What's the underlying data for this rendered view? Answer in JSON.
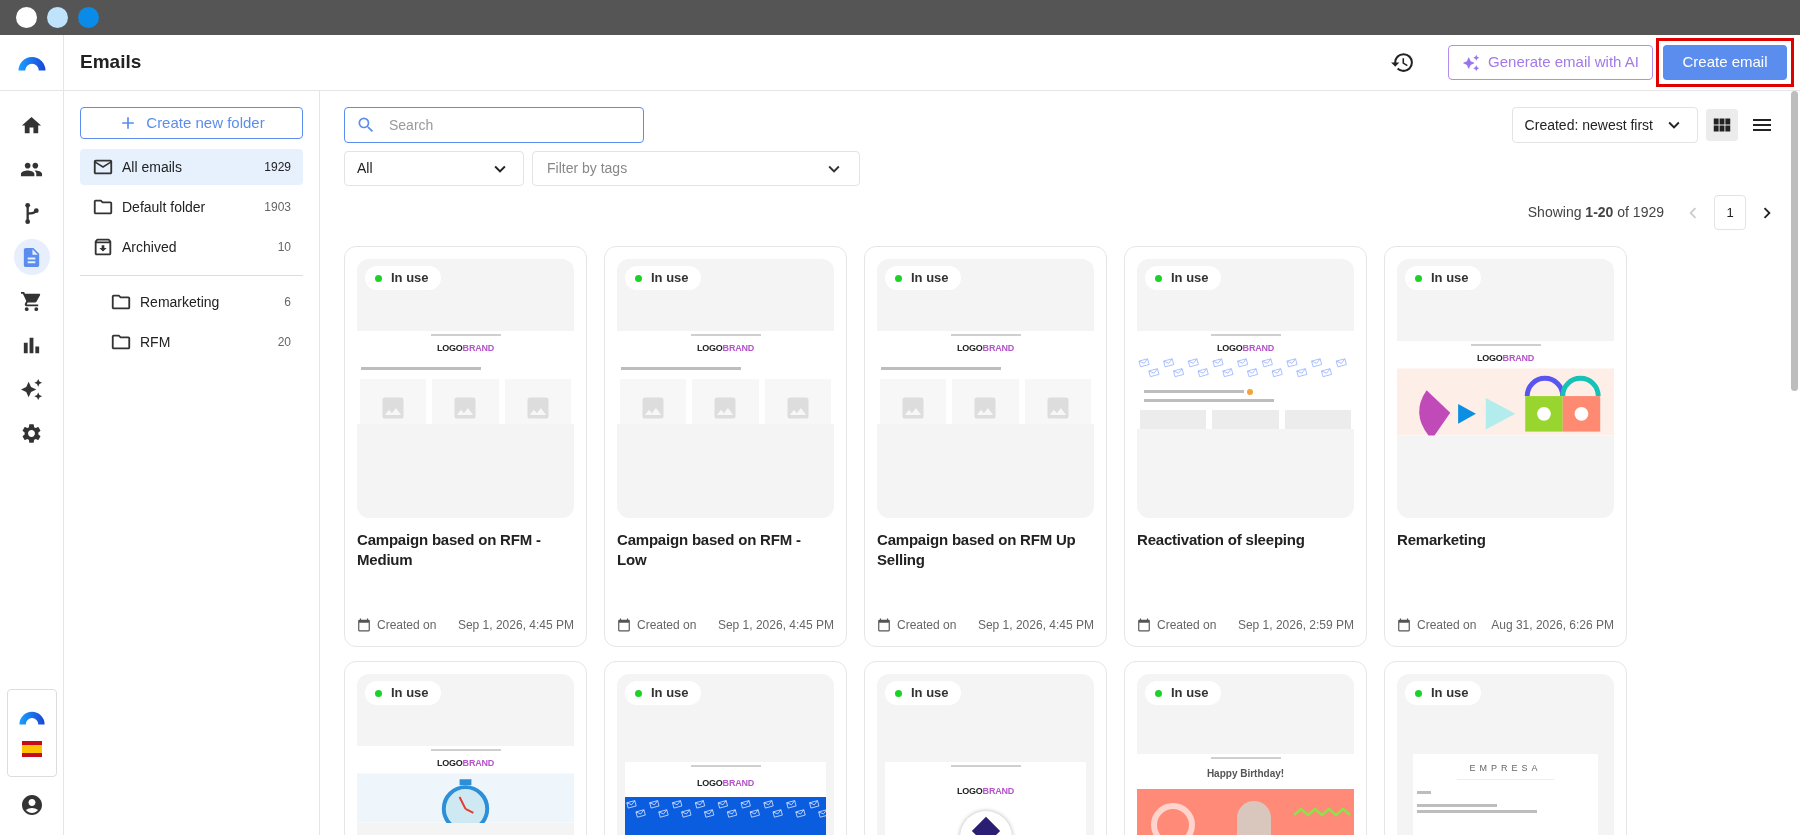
{
  "window_controls": [
    {
      "color": "#ffffff"
    },
    {
      "color": "#bfe3fb"
    },
    {
      "color": "#0a8be8"
    }
  ],
  "header": {
    "title": "Emails",
    "ai_button": "Generate email with AI",
    "create_button": "Create email",
    "create_highlighted": true
  },
  "rail": {
    "items": [
      {
        "kind": "home",
        "selected": false
      },
      {
        "kind": "contacts",
        "selected": false
      },
      {
        "kind": "flows",
        "selected": false
      },
      {
        "kind": "emails",
        "selected": true
      },
      {
        "kind": "cart",
        "selected": false
      },
      {
        "kind": "reports",
        "selected": false
      },
      {
        "kind": "ai",
        "selected": false
      },
      {
        "kind": "settings",
        "selected": false
      }
    ]
  },
  "folders": {
    "create_button": "Create new folder",
    "items": [
      {
        "kind": "mail",
        "label": "All emails",
        "count": "1929",
        "selected": true
      },
      {
        "kind": "folder",
        "label": "Default folder",
        "count": "1903",
        "selected": false
      },
      {
        "kind": "archive",
        "label": "Archived",
        "count": "10",
        "selected": false
      }
    ],
    "custom": [
      {
        "label": "Remarketing",
        "count": "6",
        "selected": false
      },
      {
        "label": "RFM",
        "count": "20",
        "selected": false
      }
    ]
  },
  "toolbar": {
    "search_placeholder": "Search",
    "type_filter": "All",
    "tags_placeholder": "Filter by tags",
    "sort": "Created: newest first",
    "views": [
      {
        "kind": "grid",
        "selected": true
      },
      {
        "kind": "list",
        "selected": false
      }
    ]
  },
  "pagination": {
    "summary": "Showing **1-20** of 1929",
    "page": "1",
    "prev_disabled": true
  },
  "cards": [
    {
      "title": "Campaign based on RFM - Medium",
      "status": "In use",
      "created_label": "Created on",
      "date": "Sep 1, 2026, 4:45 PM",
      "preview": {
        "kind": "products",
        "logo": "LOGO",
        "brand": "BRAND"
      }
    },
    {
      "title": "Campaign based on RFM - Low",
      "status": "In use",
      "created_label": "Created on",
      "date": "Sep 1, 2026, 4:45 PM",
      "preview": {
        "kind": "products",
        "logo": "LOGO",
        "brand": "BRAND"
      }
    },
    {
      "title": "Campaign based on RFM Up Selling",
      "status": "In use",
      "created_label": "Created on",
      "date": "Sep 1, 2026, 4:45 PM",
      "preview": {
        "kind": "products",
        "logo": "LOGO",
        "brand": "BRAND"
      }
    },
    {
      "title": "Reactivation of sleeping",
      "status": "In use",
      "created_label": "Created on",
      "date": "Sep 1, 2026, 2:59 PM",
      "preview": {
        "kind": "envelopes",
        "logo": "LOGO",
        "brand": "BRAND"
      }
    },
    {
      "title": "Remarketing",
      "status": "In use",
      "created_label": "Created on",
      "date": "Aug 31, 2026, 6:26 PM",
      "preview": {
        "kind": "shapes",
        "logo": "LOGO",
        "brand": "BRAND"
      }
    },
    {
      "status": "In use",
      "preview": {
        "kind": "stopwatch",
        "logo": "LOGO",
        "brand": "BRAND"
      }
    },
    {
      "status": "In use",
      "preview": {
        "kind": "envelope_banner",
        "logo": "LOGO",
        "brand": "BRAND"
      }
    },
    {
      "status": "In use",
      "preview": {
        "kind": "emblem",
        "logo": "LOGO",
        "brand": "BRAND"
      }
    },
    {
      "status": "In use",
      "preview": {
        "kind": "birthday",
        "heading": "Happy Birthday!"
      }
    },
    {
      "status": "In use",
      "preview": {
        "kind": "empresa",
        "heading": "EMPRESA"
      }
    }
  ]
}
